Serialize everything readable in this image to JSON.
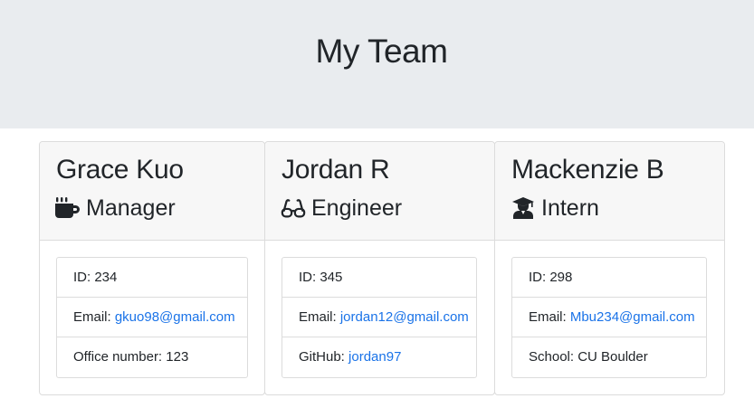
{
  "header": {
    "title": "My Team"
  },
  "cards": [
    {
      "name": "Grace Kuo",
      "role": "Manager",
      "role_icon": "coffee-mug-icon",
      "id_label": "ID: 234",
      "email_prefix": "Email: ",
      "email": "gkuo98@gmail.com",
      "extra_prefix": "Office number: 123",
      "extra_value": ""
    },
    {
      "name": "Jordan R",
      "role": "Engineer",
      "role_icon": "glasses-icon",
      "id_label": "ID: 345",
      "email_prefix": "Email: ",
      "email": "jordan12@gmail.com",
      "extra_prefix": "GitHub: ",
      "extra_value": "jordan97"
    },
    {
      "name": "Mackenzie B",
      "role": "Intern",
      "role_icon": "graduate-icon",
      "id_label": "ID: 298",
      "email_prefix": "Email: ",
      "email": "Mbu234@gmail.com",
      "extra_prefix": "School: CU Boulder",
      "extra_value": ""
    }
  ],
  "colors": {
    "link": "#1a73e8",
    "header_bg": "#e9ecef",
    "card_header_bg": "#f7f7f7"
  }
}
